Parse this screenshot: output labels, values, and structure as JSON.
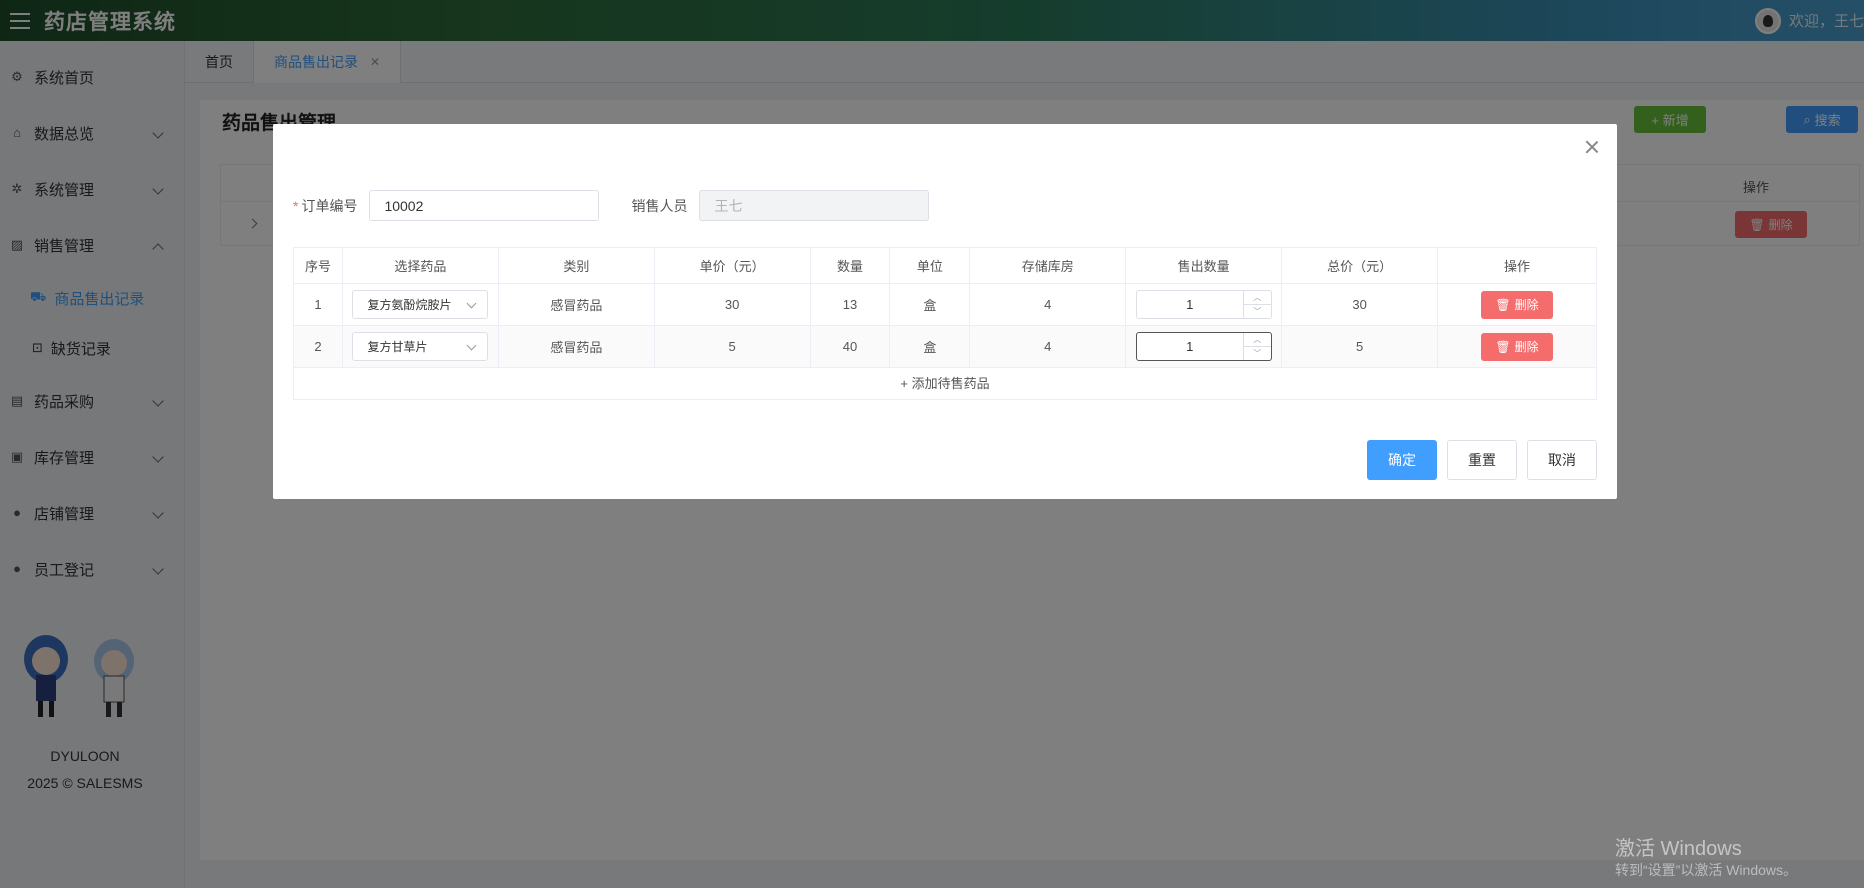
{
  "header": {
    "title": "药店管理系统",
    "welcome": "欢迎，王七"
  },
  "sidebar": {
    "items": [
      {
        "label": "系统首页"
      },
      {
        "label": "数据总览"
      },
      {
        "label": "系统管理"
      },
      {
        "label": "销售管理"
      },
      {
        "label": "商品售出记录"
      },
      {
        "label": "缺货记录"
      },
      {
        "label": "药品采购"
      },
      {
        "label": "库存管理"
      },
      {
        "label": "店铺管理"
      },
      {
        "label": "员工登记"
      }
    ],
    "footer_name": "DYULOON",
    "footer_copy": "2025 © SALESMS"
  },
  "tabs": [
    {
      "label": "首页"
    },
    {
      "label": "商品售出记录"
    }
  ],
  "page": {
    "title": "药品售出管理",
    "add_label": "+ 新增",
    "search_label": "搜索",
    "op_header": "操作",
    "row_delete": "删除"
  },
  "dialog": {
    "order_label": "订单编号",
    "order_value": "10002",
    "seller_label": "销售人员",
    "seller_placeholder": "王七",
    "columns": [
      "序号",
      "选择药品",
      "类别",
      "单价（元）",
      "数量",
      "单位",
      "存储库房",
      "售出数量",
      "总价（元）",
      "操作"
    ],
    "rows": [
      {
        "idx": "1",
        "drug": "复方氨酚烷胺片",
        "category": "感冒药品",
        "price": "30",
        "qty": "13",
        "unit": "盒",
        "store": "4",
        "sold": "1",
        "total": "30",
        "del": "删除"
      },
      {
        "idx": "2",
        "drug": "复方甘草片",
        "category": "感冒药品",
        "price": "5",
        "qty": "40",
        "unit": "盒",
        "store": "4",
        "sold": "1",
        "total": "5",
        "del": "删除"
      }
    ],
    "add_row": "+ 添加待售药品",
    "ok": "确定",
    "reset": "重置",
    "cancel": "取消"
  },
  "watermark": {
    "line1": "激活 Windows",
    "line2": "转到“设置”以激活 Windows。"
  }
}
